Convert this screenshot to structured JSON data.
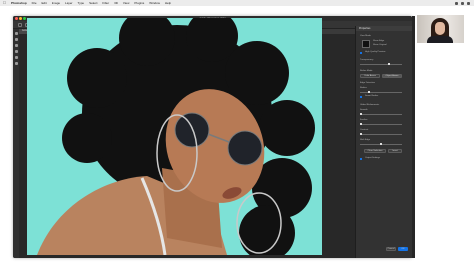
{
  "menubar": {
    "app_name": "Photoshop",
    "items": [
      "File",
      "Edit",
      "Image",
      "Layer",
      "Type",
      "Select",
      "Filter",
      "3D",
      "View",
      "Plugins",
      "Window",
      "Help"
    ]
  },
  "window": {
    "title": "Adobe Photoshop 2022",
    "traffic_colors": [
      "#ff5f57",
      "#febc2e",
      "#28c840"
    ]
  },
  "options_bar": {
    "buttons": [
      "Select Subject",
      "Select and Mask...",
      "Select All"
    ]
  },
  "document_tab": "Isolate Hair Model.psd @ 66.7% (Layer 0, RGB/8#)",
  "tooltip": "Polygonal Lasso Tool",
  "canvas": {
    "background_color": "#7de1d6"
  },
  "properties_panel": {
    "tab": "Properties",
    "view_label": "View Mode",
    "show_edge": "Show Edge",
    "show_original": "Show Original",
    "high_quality": "High Quality Preview",
    "transparency_label": "Transparency",
    "refine_mode_label": "Refine Mode",
    "color_aware": "Color Aware",
    "object_aware": "Object Aware",
    "edge_detection": "Edge Detection",
    "radius_label": "Radius",
    "smart_radius": "Smart Radius",
    "global_refinements": "Global Refinements",
    "smooth_label": "Smooth",
    "feather_label": "Feather",
    "contrast_label": "Contrast",
    "shift_edge_label": "Shift Edge",
    "clear_selection": "Clear Selection",
    "invert": "Invert",
    "output_settings": "Output Settings",
    "cancel": "Cancel",
    "ok": "OK"
  }
}
